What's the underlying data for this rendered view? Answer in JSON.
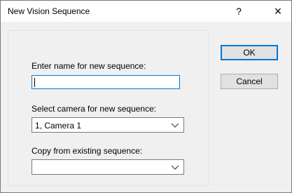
{
  "window": {
    "title": "New Vision Sequence",
    "help": "?",
    "close": "×"
  },
  "form": {
    "name_label": "Enter name for new sequence:",
    "name_value": "",
    "camera_label": "Select camera for new sequence:",
    "camera_value": "1, Camera 1",
    "copy_label": "Copy from existing sequence:",
    "copy_value": ""
  },
  "buttons": {
    "ok": "OK",
    "cancel": "Cancel"
  },
  "colors": {
    "focus": "#0078d7",
    "dialog_bg": "#f0f0f0",
    "button_bg": "#e1e1e1"
  }
}
